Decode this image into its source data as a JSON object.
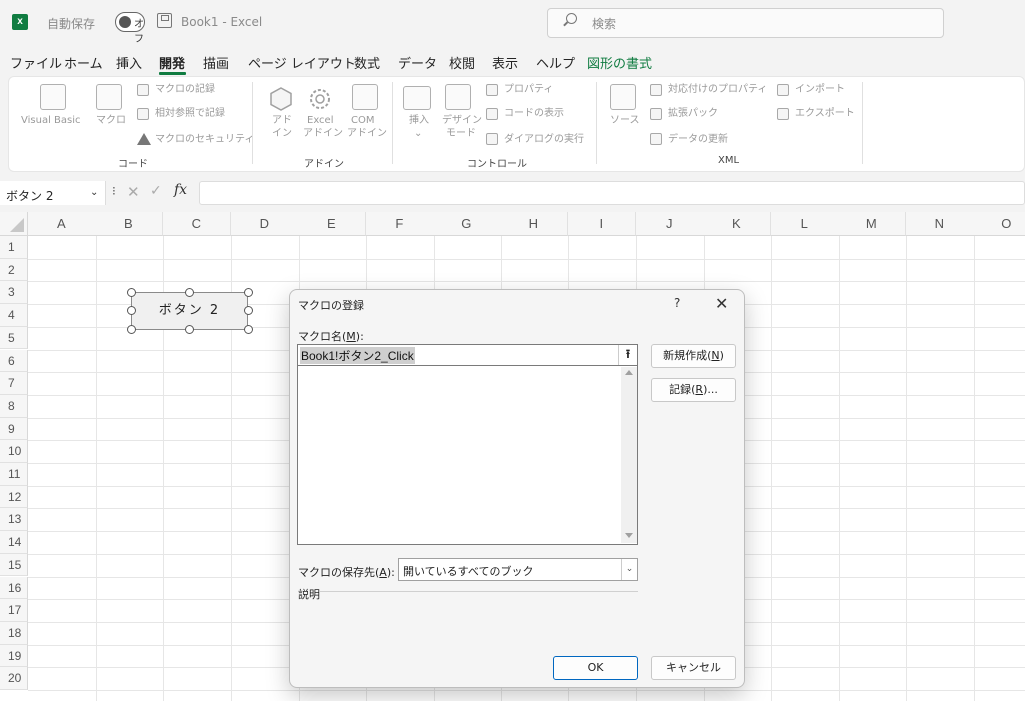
{
  "titlebar": {
    "logo": "x",
    "autosave_label": "自動保存",
    "autosave_state": "オフ",
    "doc_title": "Book1  -  Excel",
    "search_placeholder": "検索"
  },
  "menu": {
    "tabs": [
      "ファイル",
      "ホーム",
      "挿入",
      "開発",
      "描画",
      "ページ レイアウト",
      "数式",
      "データ",
      "校閲",
      "表示",
      "ヘルプ",
      "図形の書式"
    ],
    "active": "開発"
  },
  "ribbon": {
    "code": {
      "group_label": "コード",
      "visual_basic": "Visual Basic",
      "macro": "マクロ",
      "record_macro": "マクロの記録",
      "relative_ref": "相対参照で記録",
      "macro_security": "マクロのセキュリティ"
    },
    "addins": {
      "group_label": "アドイン",
      "addin_line1": "アド",
      "addin_line2": "イン",
      "excel_line1": "Excel",
      "excel_line2": "アドイン",
      "com_line1": "COM",
      "com_line2": "アドイン"
    },
    "controls": {
      "group_label": "コントロール",
      "insert": "挿入",
      "insert_arrow": "⌄",
      "design_line1": "デザイン",
      "design_line2": "モード",
      "properties": "プロパティ",
      "view_code": "コードの表示",
      "run_dialog": "ダイアログの実行"
    },
    "xml": {
      "group_label": "XML",
      "source": "ソース",
      "map_properties": "対応付けのプロパティ",
      "expansion_packs": "拡張パック",
      "refresh_data": "データの更新",
      "import": "インポート",
      "export": "エクスポート"
    }
  },
  "formula_bar": {
    "name_box": "ボタン 2",
    "dropdown": "⌄",
    "dots": "⁝",
    "cancel": "✕",
    "enter": "✓",
    "fx": "fx",
    "value": ""
  },
  "sheet": {
    "columns": [
      "A",
      "B",
      "C",
      "D",
      "E",
      "F",
      "G",
      "H",
      "I",
      "J",
      "K",
      "L",
      "M",
      "N",
      "O"
    ],
    "rows": [
      "1",
      "2",
      "3",
      "4",
      "5",
      "6",
      "7",
      "8",
      "9",
      "10",
      "11",
      "12",
      "13",
      "14",
      "15",
      "16",
      "17",
      "18",
      "19",
      "20"
    ],
    "shape_button_text": "ボタン 2"
  },
  "dialog": {
    "title": "マクロの登録",
    "help": "?",
    "close": "✕",
    "macro_name_label_pre": "マクロ名(",
    "macro_name_label_key": "M",
    "macro_name_label_post": "):",
    "macro_name_value": "Book1!ボタン2_Click",
    "collapse_glyph": "⭱",
    "new_button_pre": "新規作成(",
    "new_button_key": "N",
    "new_button_post": ")",
    "record_button_pre": "記録(",
    "record_button_key": "R",
    "record_button_post": ")...",
    "macros_in_label_pre": "マクロの保存先(",
    "macros_in_label_key": "A",
    "macros_in_label_post": "):",
    "macros_in_value": "開いているすべてのブック",
    "description_label": "説明",
    "ok": "OK",
    "cancel": "キャンセル"
  },
  "colors": {
    "accent": "#107c41",
    "default_button_border": "#0067c0"
  }
}
